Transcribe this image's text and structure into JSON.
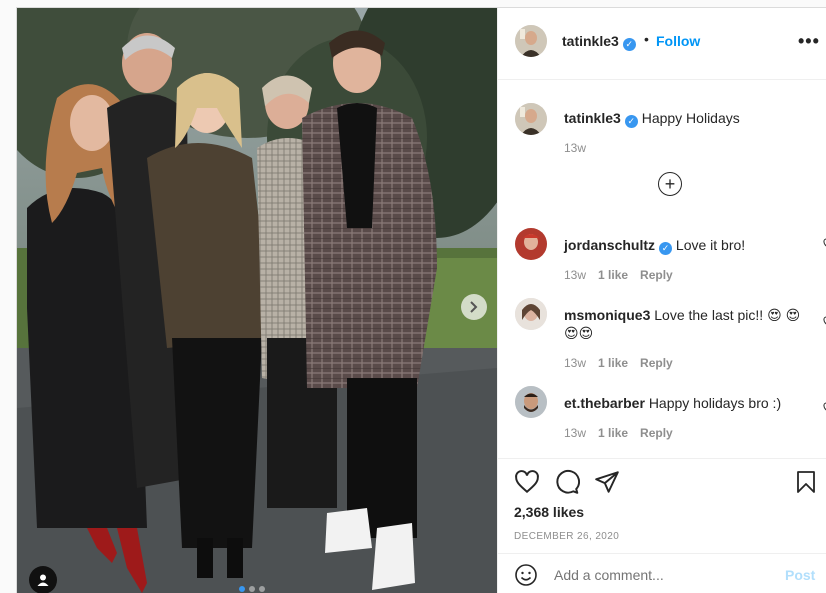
{
  "header": {
    "username": "tatinkle3",
    "follow_label": "Follow",
    "separator": "•",
    "more_label": "•••"
  },
  "caption": {
    "username": "tatinkle3",
    "text": "Happy Holidays",
    "time": "13w"
  },
  "load_more_label": "+",
  "comments": [
    {
      "username": "jordanschultz",
      "verified": true,
      "text": "Love it bro!",
      "time": "13w",
      "likes": "1 like",
      "reply": "Reply"
    },
    {
      "username": "msmonique3",
      "verified": false,
      "text": "Love the last pic!! 😍 😍😍😍",
      "time": "13w",
      "likes": "1 like",
      "reply": "Reply"
    },
    {
      "username": "et.thebarber",
      "verified": false,
      "text": "Happy holidays bro :)",
      "time": "13w",
      "likes": "1 like",
      "reply": "Reply"
    }
  ],
  "icons": {
    "like": "heart-icon",
    "comment": "comment-bubble-icon",
    "share": "paper-plane-icon",
    "save": "bookmark-icon",
    "emoji": "smiley-icon",
    "next": "chevron-right-icon",
    "tags": "user-tag-icon"
  },
  "likes_text": "2,368 likes",
  "date_text": "DECEMBER 26, 2020",
  "add_comment": {
    "placeholder": "Add a comment...",
    "post_label": "Post"
  },
  "carousel": {
    "total": 3,
    "current": 1
  },
  "colors": {
    "accent": "#0095f6",
    "verified": "#3897f0",
    "muted": "#8e8e8e",
    "post_disabled": "#b2dffc"
  }
}
